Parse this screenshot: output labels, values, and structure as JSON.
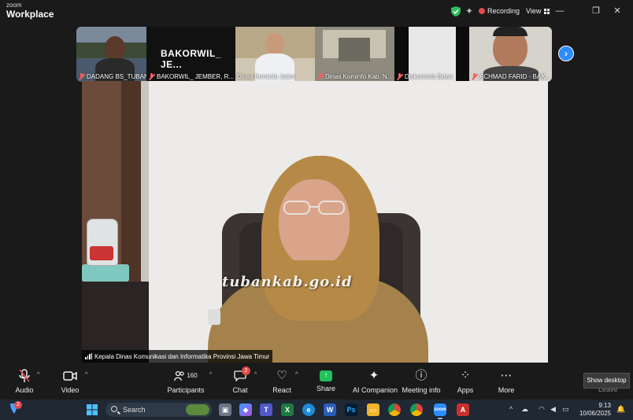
{
  "app": {
    "brand_top": "zoom",
    "brand_bottom": "Workplace",
    "recording_label": "Recording",
    "view_label": "View"
  },
  "gallery": {
    "tiles": [
      {
        "name": "DADANG BS_TUBAN",
        "muted": true
      },
      {
        "name": "BAKORWIL_ JEMBER, R...",
        "display_text": "BAKORWIL_  JE...",
        "muted": true
      },
      {
        "name": "Dinas Kominfo Jatim",
        "muted": false
      },
      {
        "name": "Dinas Kominfo Kab. N...",
        "muted": true
      },
      {
        "name": "Diskominfo Bdws",
        "muted": true
      },
      {
        "name": "ACHMAD FARID - BAK...",
        "muted": true
      }
    ],
    "next_icon": "chevron-right-icon"
  },
  "main_video": {
    "speaker_name": "Kepala Dinas Komunikasi dan Informatika Provinsi Jawa Timur",
    "watermark": "tubankab.go.id"
  },
  "toolbar": {
    "audio_label": "Audio",
    "video_label": "Video",
    "participants_label": "Participants",
    "participants_count": "160",
    "chat_label": "Chat",
    "chat_badge": "2",
    "react_label": "React",
    "share_label": "Share",
    "ai_label": "AI Companion",
    "meeting_info_label": "Meeting info",
    "apps_label": "Apps",
    "more_label": "More",
    "leave_label": "Leave",
    "tooltip": "Show desktop"
  },
  "taskbar": {
    "notification_badge": "2",
    "search_placeholder": "Search",
    "time": "9:13",
    "date": "10/06/2025"
  },
  "colors": {
    "accent": "#2d8cff",
    "muted_red": "#f06060",
    "share_green": "#22c05a",
    "hijab": "#b68a46"
  }
}
